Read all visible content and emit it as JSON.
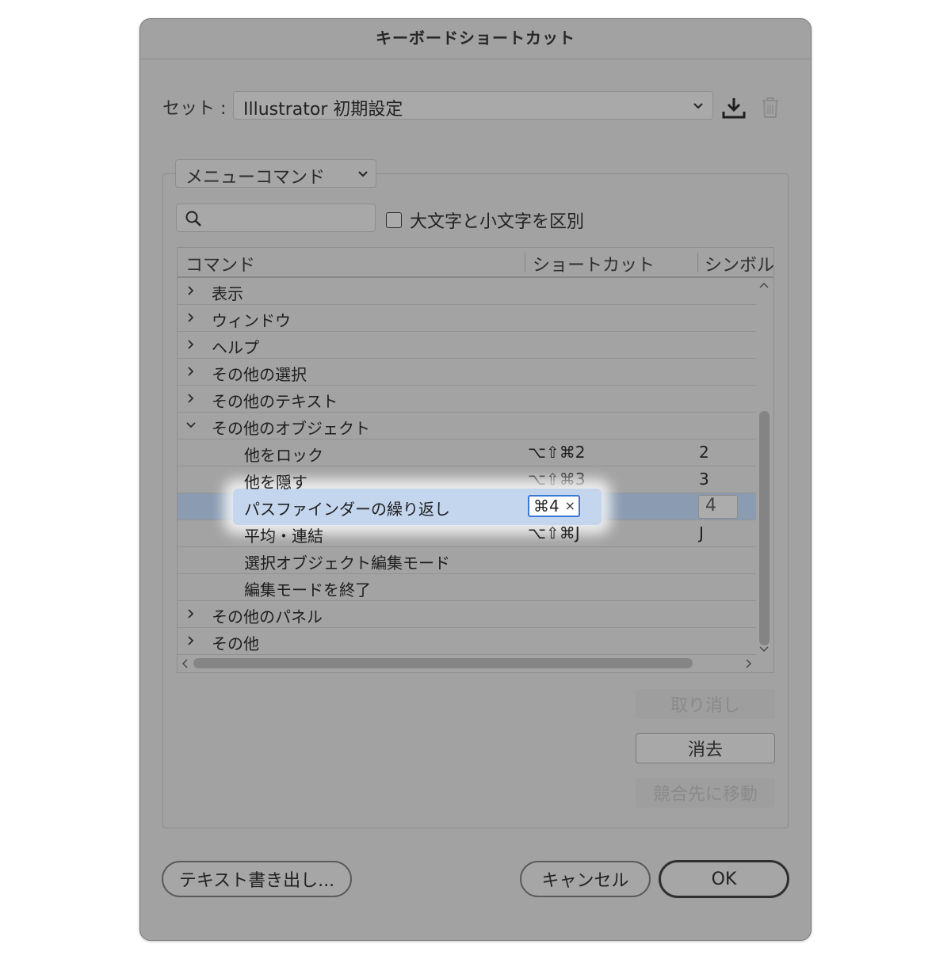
{
  "dialog": {
    "title": "キーボードショートカット"
  },
  "set": {
    "label": "セット :",
    "value": "Illustrator 初期設定"
  },
  "icons": {
    "save": "download-icon",
    "delete": "trash-icon",
    "search": "search-icon"
  },
  "command_type": {
    "value": "メニューコマンド"
  },
  "search": {
    "placeholder": ""
  },
  "case_sensitive": {
    "label": "大文字と小文字を区別",
    "checked": false
  },
  "table": {
    "headers": {
      "command": "コマンド",
      "shortcut": "ショートカット",
      "symbol": "シンボル"
    },
    "rows": [
      {
        "label": "表示",
        "indent": 0,
        "arrow": "right",
        "shortcut": "",
        "symbol": ""
      },
      {
        "label": "ウィンドウ",
        "indent": 0,
        "arrow": "right",
        "shortcut": "",
        "symbol": ""
      },
      {
        "label": "ヘルプ",
        "indent": 0,
        "arrow": "right",
        "shortcut": "",
        "symbol": ""
      },
      {
        "label": "その他の選択",
        "indent": 0,
        "arrow": "right",
        "shortcut": "",
        "symbol": ""
      },
      {
        "label": "その他のテキスト",
        "indent": 0,
        "arrow": "right",
        "shortcut": "",
        "symbol": ""
      },
      {
        "label": "その他のオブジェクト",
        "indent": 0,
        "arrow": "down",
        "shortcut": "",
        "symbol": ""
      },
      {
        "label": "他をロック",
        "indent": 1,
        "arrow": "",
        "shortcut": "⌥⇧⌘2",
        "symbol": "2"
      },
      {
        "label": "他を隠す",
        "indent": 1,
        "arrow": "",
        "shortcut": "⌥⇧⌘3",
        "symbol": "3"
      },
      {
        "label": "パスファインダーの繰り返し",
        "indent": 1,
        "arrow": "",
        "shortcut": "⌘4",
        "symbol": "4",
        "selected": true
      },
      {
        "label": "平均・連結",
        "indent": 1,
        "arrow": "",
        "shortcut": "⌥⇧⌘J",
        "symbol": "J"
      },
      {
        "label": "選択オブジェクト編集モード",
        "indent": 1,
        "arrow": "",
        "shortcut": "",
        "symbol": ""
      },
      {
        "label": "編集モードを終了",
        "indent": 1,
        "arrow": "",
        "shortcut": "",
        "symbol": ""
      },
      {
        "label": "その他のパネル",
        "indent": 0,
        "arrow": "right",
        "shortcut": "",
        "symbol": ""
      },
      {
        "label": "その他",
        "indent": 0,
        "arrow": "right",
        "shortcut": "",
        "symbol": ""
      }
    ],
    "clear_glyph": "×"
  },
  "buttons": {
    "undo": "取り消し",
    "clear": "消去",
    "go_conflict": "競合先に移動",
    "export_text": "テキスト書き出し...",
    "cancel": "キャンセル",
    "ok": "OK"
  },
  "colors": {
    "dialog_bg": "#a2a2a2",
    "selection": "#8a9bb2",
    "focus_ring": "#3a78d8"
  }
}
